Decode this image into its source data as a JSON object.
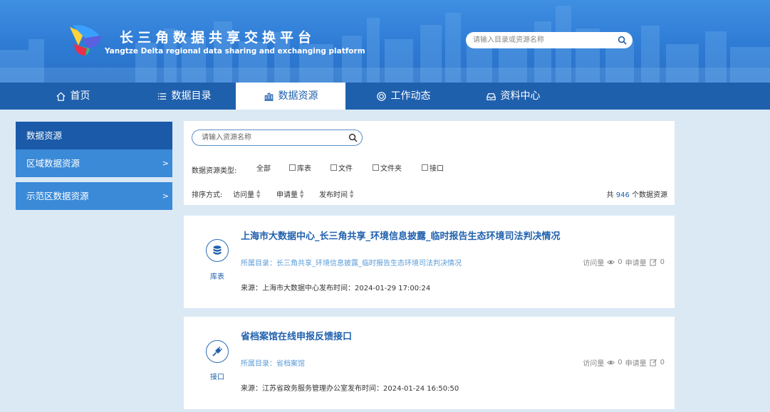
{
  "header": {
    "title_cn": "长三角数据共享交换平台",
    "title_en": "Yangtze Delta regional data sharing and exchanging platform",
    "search_placeholder": "请输入目录或资源名称"
  },
  "nav": {
    "items": [
      {
        "label": "首页",
        "icon": "home-icon"
      },
      {
        "label": "数据目录",
        "icon": "list-icon"
      },
      {
        "label": "数据资源",
        "icon": "bar-chart-icon",
        "active": true
      },
      {
        "label": "工作动态",
        "icon": "target-icon"
      },
      {
        "label": "资料中心",
        "icon": "inbox-icon"
      }
    ]
  },
  "sidebar": {
    "items": [
      {
        "label": "数据资源",
        "arrow": ""
      },
      {
        "label": "区域数据资源",
        "arrow": ">"
      },
      {
        "label": "示范区数据资源",
        "arrow": ">"
      }
    ]
  },
  "filter": {
    "search_placeholder": "请输入资源名称",
    "type_label": "数据资源类型:",
    "types": [
      {
        "label": "全部",
        "checkbox": false
      },
      {
        "label": "库表",
        "checkbox": true
      },
      {
        "label": "文件",
        "checkbox": true
      },
      {
        "label": "文件夹",
        "checkbox": true
      },
      {
        "label": "接口",
        "checkbox": true
      }
    ],
    "sort_label": "排序方式:",
    "sort_options": [
      "访问量",
      "申请量",
      "发布时间"
    ],
    "total_prefix": "共",
    "total_count": "946",
    "total_suffix": "个数据资源"
  },
  "results": [
    {
      "type": "库表",
      "icon": "database-icon",
      "title": "上海市大数据中心_长三角共享_环境信息披露_临时报告生态环境司法判决情况",
      "catalog": "所属目录：长三角共享_环境信息披露_临时报告生态环境司法判决情况",
      "visits_label": "访问量",
      "visits": "0",
      "apply_label": "申请量",
      "apply": "0",
      "source": "来源：上海市大数据中心发布时间：2024-01-29 17:00:24"
    },
    {
      "type": "接口",
      "icon": "plug-icon",
      "title": "省档案馆在线申报反馈接口",
      "catalog": "所属目录：省档案馆",
      "visits_label": "访问量",
      "visits": "0",
      "apply_label": "申请量",
      "apply": "0",
      "source": "来源：江苏省政务服务管理办公室发布时间：2024-01-24 16:50:50"
    }
  ],
  "colors": {
    "primary": "#1f60ad",
    "sidebar_active": "#1a5aa8",
    "sidebar_item": "#3a8ad8",
    "page_bg": "#dbe9f5"
  }
}
